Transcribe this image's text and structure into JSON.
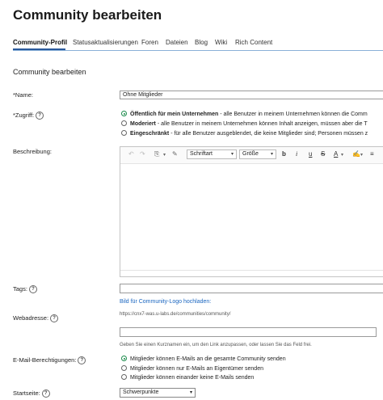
{
  "page": {
    "title": "Community bearbeiten",
    "tabs": [
      {
        "label": "Community-Profil",
        "active": true
      },
      {
        "label": "Statusaktualisierungen",
        "active": false
      },
      {
        "label": "Foren",
        "active": false
      },
      {
        "label": "Dateien",
        "active": false
      },
      {
        "label": "Blog",
        "active": false
      },
      {
        "label": "Wiki",
        "active": false
      },
      {
        "label": "Rich Content",
        "active": false
      }
    ],
    "section_title": "Community bearbeiten"
  },
  "form": {
    "name": {
      "label": "*Name:",
      "value": "Ohne Mitglieder"
    },
    "access": {
      "label": "*Zugriff:",
      "help": "?",
      "options": [
        {
          "title": "Öffentlich für mein Unternehmen",
          "desc": " - alle Benutzer in meinem Unternehmen können die Comm",
          "selected": true
        },
        {
          "title": "Moderiert",
          "desc": " - alle Benutzer in meinem Unternehmen können Inhalt anzeigen, müssen aber die T",
          "selected": false
        },
        {
          "title": "Eingeschränkt",
          "desc": " - für alle Benutzer ausgeblendet, die keine Mitglieder sind; Personen müssen z",
          "selected": false
        }
      ]
    },
    "description": {
      "label": "Beschreibung:",
      "toolbar": {
        "undo_icon": "↶",
        "redo_icon": "↷",
        "paste_icon": "⎘",
        "dropdown_icon": "▾",
        "brush_icon": "✎",
        "font": "Schriftart",
        "size": "Größe",
        "bold": "b",
        "italic": "i",
        "underline": "u",
        "strike": "S",
        "font_color": "A",
        "highlight": "✍",
        "align": "≡"
      }
    },
    "tags": {
      "label": "Tags:",
      "help": "?",
      "value": ""
    },
    "logo_link": "Bild für Community-Logo hochladen:",
    "web": {
      "label": "Webadresse:",
      "help": "?",
      "url": "https://cnx7-was.u-labs.de/communities/community/",
      "value": "",
      "hint": "Geben Sie einen Kurznamen ein, um den Link anzupassen, oder lassen Sie das Feld frei."
    },
    "email": {
      "label": "E-Mail-Berechtigungen:",
      "help": "?",
      "options": [
        {
          "text": "Mitglieder können E-Mails an die gesamte Community senden",
          "selected": true
        },
        {
          "text": "Mitglieder können nur E-Mails an Eigentümer senden",
          "selected": false
        },
        {
          "text": "Mitglieder können einander keine E-Mails senden",
          "selected": false
        }
      ]
    },
    "start_page": {
      "label": "Startseite:",
      "help": "?",
      "value": "Schwerpunkte",
      "arrow": "▾"
    }
  }
}
